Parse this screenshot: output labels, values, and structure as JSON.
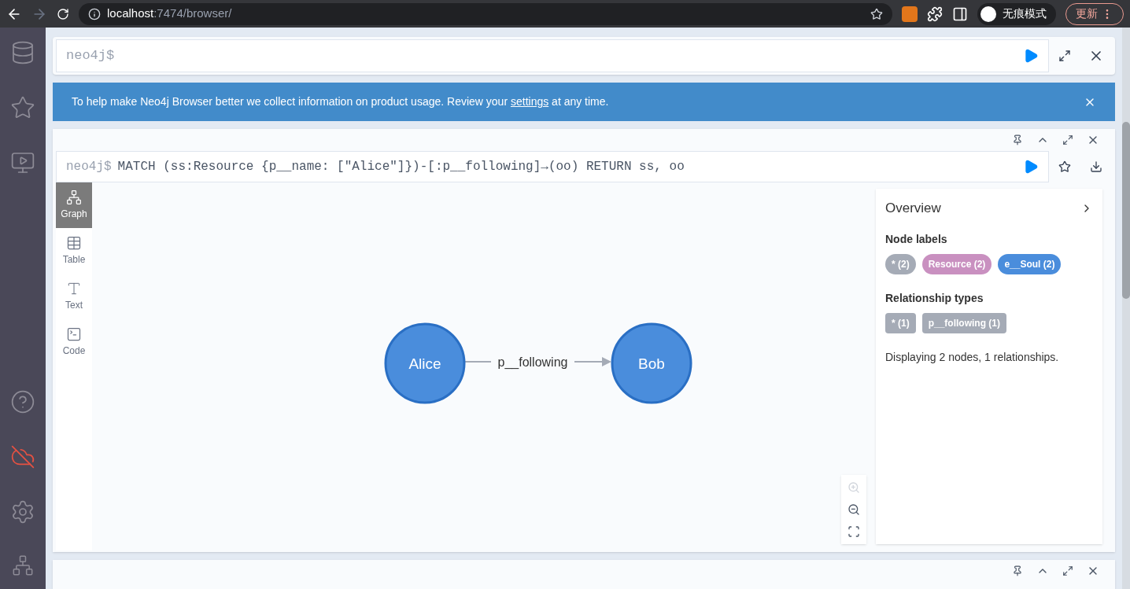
{
  "browser": {
    "url_host": "localhost",
    "url_path": ":7474/browser/",
    "profile": "无痕模式",
    "update": "更新"
  },
  "editor": {
    "prompt": "neo4j$"
  },
  "banner": {
    "before": "To help make Neo4j Browser better we collect information on product usage. Review your ",
    "link": "settings",
    "after": " at any time."
  },
  "frame": {
    "prompt": "neo4j$",
    "query": "MATCH (ss:Resource {p__name: [\"Alice\"]})-[:p__following]→(oo) RETURN ss, oo",
    "views": [
      {
        "kind": "graph",
        "label": "Graph",
        "selected": true
      },
      {
        "kind": "table",
        "label": "Table",
        "selected": false
      },
      {
        "kind": "text",
        "label": "Text",
        "selected": false
      },
      {
        "kind": "code",
        "label": "Code",
        "selected": false
      }
    ],
    "graph": {
      "nodes": [
        {
          "caption": "Alice",
          "color": "#4a8ddc"
        },
        {
          "caption": "Bob",
          "color": "#4a8ddc"
        }
      ],
      "relationship": "p__following"
    },
    "zoom_in": {
      "disabled": true
    },
    "overview": {
      "title": "Overview",
      "node_labels_title": "Node labels",
      "node_labels": [
        {
          "text": "* (2)",
          "color": "#a5abb6"
        },
        {
          "text": "Resource (2)",
          "color": "#c990c0"
        },
        {
          "text": "e__Soul (2)",
          "color": "#4a8ddc"
        }
      ],
      "relationship_types_title": "Relationship types",
      "relationship_types": [
        {
          "text": "* (1)"
        },
        {
          "text": "p__following (1)"
        }
      ],
      "summary": "Displaying 2 nodes, 1 relationships."
    }
  }
}
